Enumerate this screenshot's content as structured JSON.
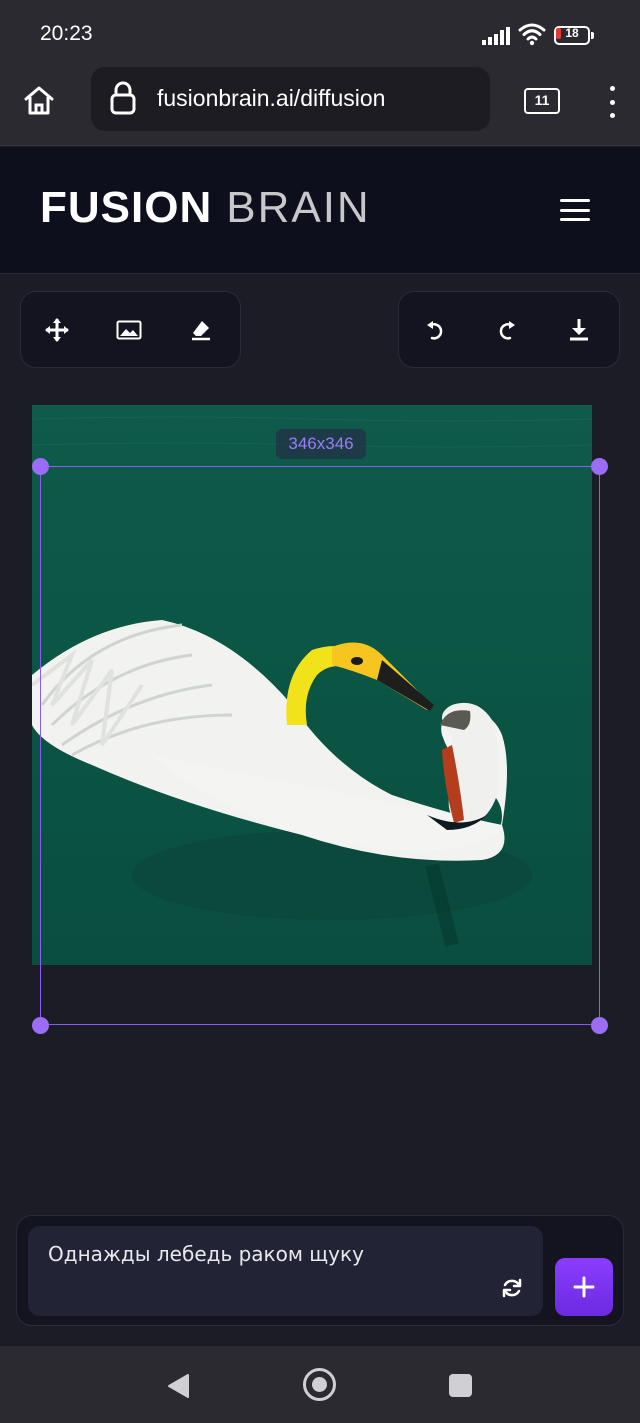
{
  "status_bar": {
    "time": "20:23",
    "battery_level": "18",
    "icons": [
      "signal-icon",
      "wifi-icon",
      "battery-icon"
    ]
  },
  "browser": {
    "url": "fusionbrain.ai/diffusion",
    "tab_count": "11",
    "icons": [
      "home-icon",
      "lock-icon",
      "tabs-icon",
      "more-icon"
    ]
  },
  "app": {
    "logo_bold": "FUSION",
    "logo_light": "BRAIN",
    "menu_icon": "hamburger-menu-icon"
  },
  "toolbar_left": {
    "tools": [
      "move-icon",
      "image-icon",
      "eraser-icon"
    ]
  },
  "toolbar_right": {
    "tools": [
      "undo-icon",
      "redo-icon",
      "download-icon"
    ]
  },
  "canvas": {
    "selection_size": "346x346",
    "accent_color": "#8a5cf6",
    "water_color": "#0c5645"
  },
  "prompt": {
    "text": "Однажды лебедь раком щуку",
    "refresh_icon": "refresh-icon",
    "add_label": "+"
  },
  "android_nav": {
    "icons": [
      "back-icon",
      "home-circle-icon",
      "recents-icon"
    ]
  }
}
